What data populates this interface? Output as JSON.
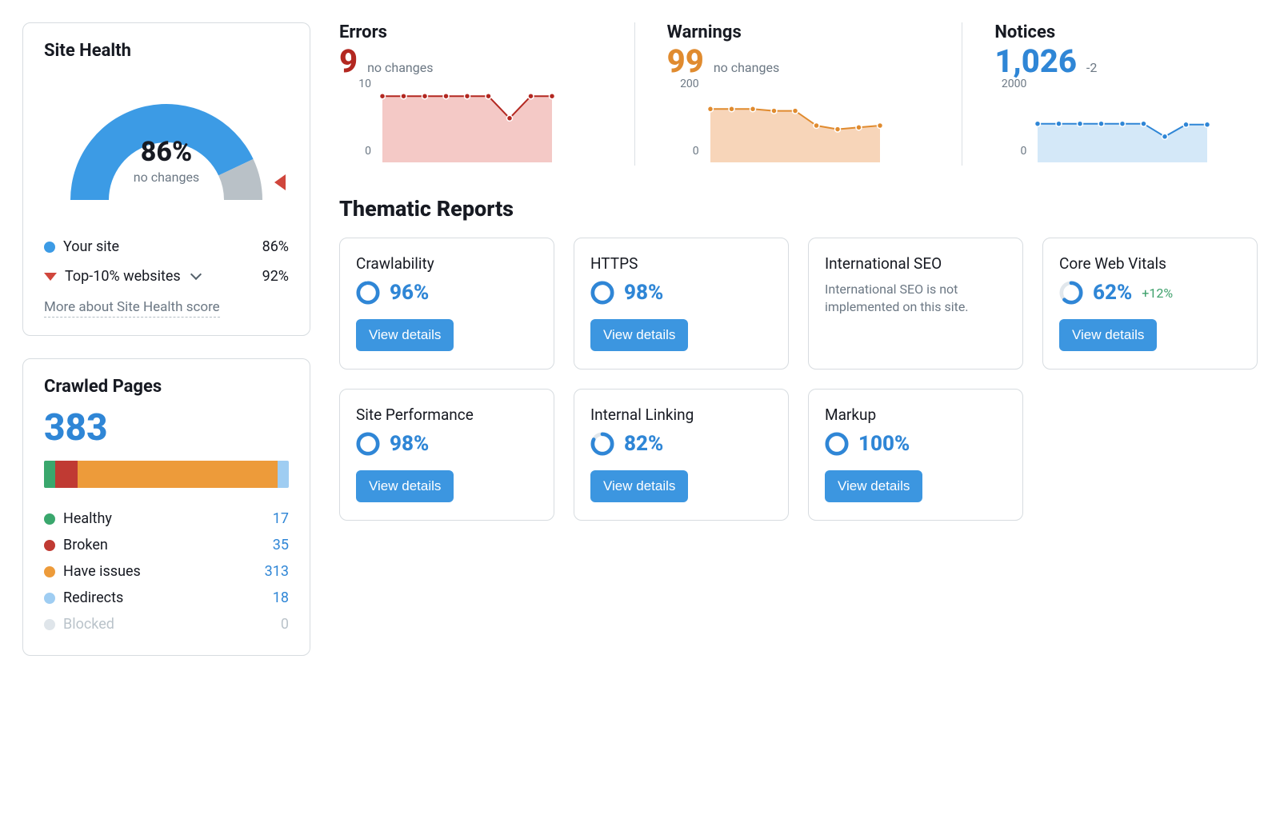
{
  "site_health": {
    "title": "Site Health",
    "percent_label": "86%",
    "percent_value": 86,
    "subtext": "no changes",
    "legend": {
      "your_site": {
        "label": "Your site",
        "value": "86%"
      },
      "top10": {
        "label": "Top-10% websites",
        "value": "92%"
      }
    },
    "info_link": "More about Site Health score",
    "gauge_color": "#3c9be5",
    "gauge_remainder_color": "#b9c1c7"
  },
  "crawled_pages": {
    "title": "Crawled Pages",
    "total": "383",
    "breakdown": [
      {
        "label": "Healthy",
        "value": "17",
        "num": 17,
        "color": "#3aa76d"
      },
      {
        "label": "Broken",
        "value": "35",
        "num": 35,
        "color": "#c03a33"
      },
      {
        "label": "Have issues",
        "value": "313",
        "num": 313,
        "color": "#ed9b3a"
      },
      {
        "label": "Redirects",
        "value": "18",
        "num": 18,
        "color": "#9fcdf2"
      },
      {
        "label": "Blocked",
        "value": "0",
        "num": 0,
        "color": "#dfe5ea"
      }
    ]
  },
  "metric_errors": {
    "title": "Errors",
    "value": "9",
    "change": "no changes",
    "color": "#b32821",
    "fill": "#f4c9c6",
    "y_top": "10",
    "y_bottom": "0"
  },
  "metric_warnings": {
    "title": "Warnings",
    "value": "99",
    "change": "no changes",
    "color": "#e08b2f",
    "fill": "#f7d5b9",
    "y_top": "200",
    "y_bottom": "0"
  },
  "metric_notices": {
    "title": "Notices",
    "value": "1,026",
    "change": "-2",
    "color": "#2f86d6",
    "fill": "#d4e8f8",
    "y_top": "2000",
    "y_bottom": "0"
  },
  "chart_data": [
    {
      "type": "area",
      "title": "Errors",
      "ylim": [
        0,
        10
      ],
      "values": [
        9,
        9,
        9,
        9,
        9,
        9,
        6,
        9,
        9
      ]
    },
    {
      "type": "area",
      "title": "Warnings",
      "ylim": [
        0,
        200
      ],
      "values": [
        145,
        145,
        145,
        140,
        140,
        100,
        90,
        95,
        100
      ]
    },
    {
      "type": "area",
      "title": "Notices",
      "ylim": [
        0,
        2000
      ],
      "values": [
        1050,
        1050,
        1050,
        1050,
        1050,
        1050,
        700,
        1026,
        1026
      ]
    }
  ],
  "thematic": {
    "title": "Thematic Reports",
    "view_details_label": "View details",
    "cards": [
      {
        "title": "Crawlability",
        "percent_label": "96%",
        "percent": 96,
        "delta": ""
      },
      {
        "title": "HTTPS",
        "percent_label": "98%",
        "percent": 98,
        "delta": ""
      },
      {
        "title": "International SEO",
        "desc": "International SEO is not implemented on this site."
      },
      {
        "title": "Core Web Vitals",
        "percent_label": "62%",
        "percent": 62,
        "delta": "+12%"
      },
      {
        "title": "Site Performance",
        "percent_label": "98%",
        "percent": 98,
        "delta": ""
      },
      {
        "title": "Internal Linking",
        "percent_label": "82%",
        "percent": 82,
        "delta": ""
      },
      {
        "title": "Markup",
        "percent_label": "100%",
        "percent": 100,
        "delta": ""
      }
    ]
  }
}
